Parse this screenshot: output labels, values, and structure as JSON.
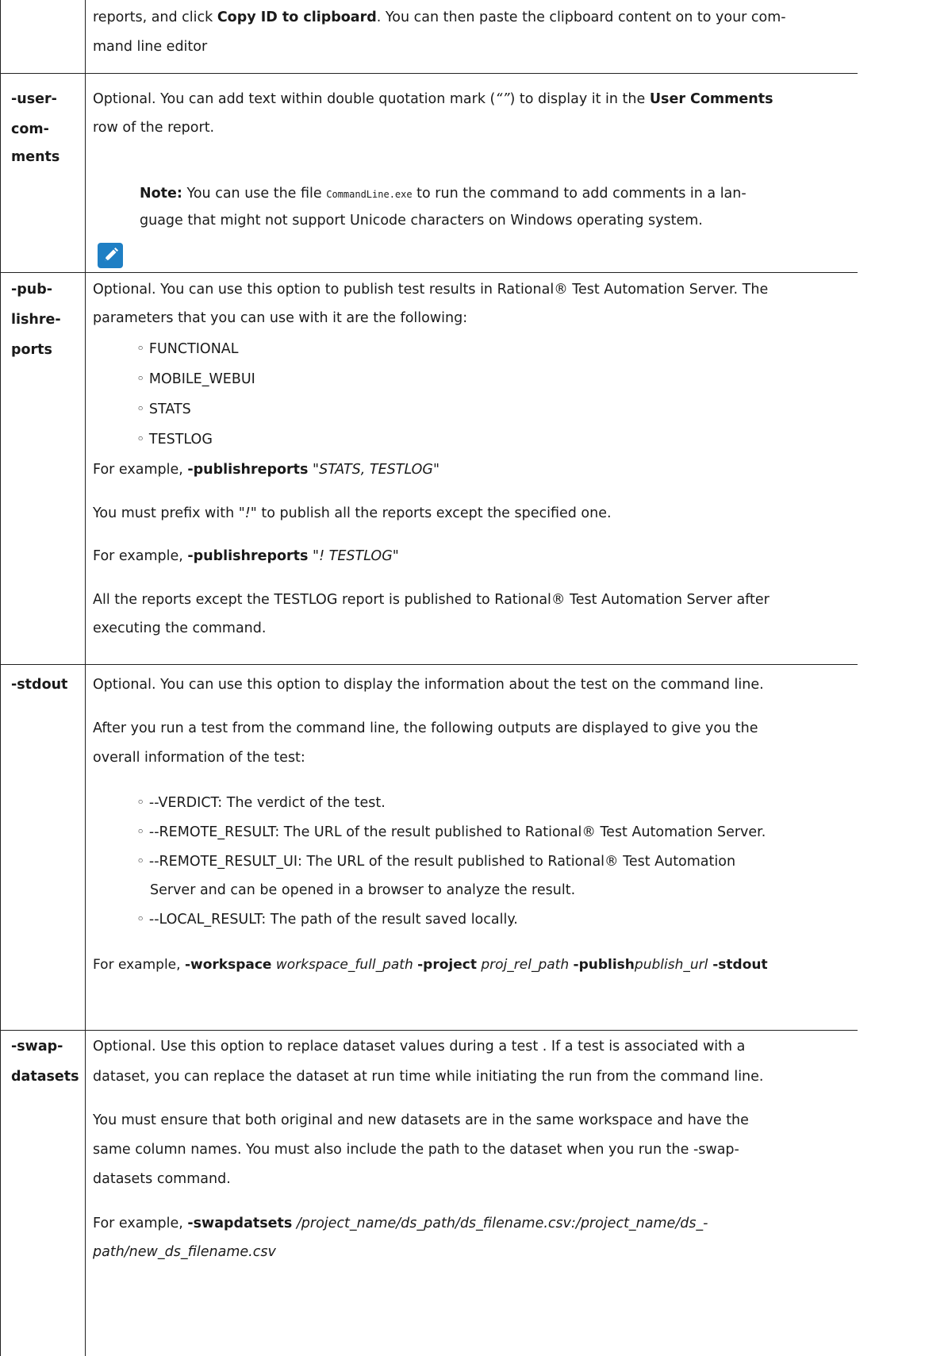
{
  "row_top": {
    "line1": {
      "a": "reports, and click ",
      "b": "Copy ID to clipboard",
      "c": ". You can then paste the clipboard content on to your com-"
    },
    "line2": "mand line editor"
  },
  "row_user_comments": {
    "key_lines": [
      "-user-",
      "com-",
      "ments"
    ],
    "line1": {
      "a": "Optional. You can add text within double quotation mark (",
      "q": "“”",
      "b": ") to display it in the ",
      "c": "User Comments"
    },
    "line2": "row of the report.",
    "note": {
      "label": "Note:",
      "a": " You can use the file ",
      "code": "CommandLine.exe",
      "b": " to run the command to add comments in a lan-",
      "line2": "guage that might not support Unicode characters on Windows operating system."
    }
  },
  "row_publishreports": {
    "key_lines": [
      "-pub-",
      "lishre-",
      "ports"
    ],
    "line1": "Optional. You can use this option to publish test results in Rational® Test Automation Server. The",
    "line2": "parameters that you can use with it are the following:",
    "params": [
      "FUNCTIONAL",
      "MOBILE_WEBUI",
      "STATS",
      "TESTLOG"
    ],
    "example1": {
      "a": "For example, ",
      "b": "-publishreports",
      "c": " \"STATS, TESTLOG\""
    },
    "prefix": {
      "a": "You must prefix with ",
      "b": "\"!\"",
      "c": " to publish all the reports except the specified one."
    },
    "example2": {
      "a": "For example, ",
      "b": "-publishreports",
      "c": " \"! TESTLOG\""
    },
    "result_line1": "All the reports except the TESTLOG report is published to Rational® Test Automation Server after",
    "result_line2": "executing the command."
  },
  "row_stdout": {
    "key": "-stdout",
    "line1": "Optional. You can use this option to display the information about the test on the command line.",
    "after1": "After you run a test from the command line, the following outputs are displayed to give you the",
    "after2": "overall information of the test:",
    "outputs": [
      "--VERDICT: The verdict of the test.",
      "--REMOTE_RESULT: The URL of the result published to Rational® Test Automation Server.",
      "--REMOTE_RESULT_UI: The URL of the result published to Rational® Test Automation",
      "--LOCAL_RESULT: The path of the result saved locally."
    ],
    "output3_cont": "Server and can be opened in a browser to analyze the result.",
    "example": {
      "a": "For example, ",
      "b": "-workspace",
      "c": " workspace_full_path ",
      "d": "-project",
      "e": " proj_rel_path ",
      "f": "-publish",
      "g": "publish_url",
      "h": " -stdout"
    }
  },
  "row_swapdatasets": {
    "key_lines": [
      "-swap-",
      "datasets"
    ],
    "line1": "Optional. Use this option to replace dataset values during a test . If a test is associated with a",
    "line2": "dataset, you can replace the dataset at run time while initiating the run from the command line.",
    "ensure1": "You must ensure that both original and new datasets are in the same workspace and have the",
    "ensure2": "same column names. You must also include the path to the dataset when you run the -swap-",
    "ensure3": "datasets command.",
    "example": {
      "a": "For example, ",
      "b": "-swapdatsets",
      "c": "  /project_name/ds_path/ds_filename.csv:/project_name/ds_-"
    },
    "example_line2": "path/new_ds_filename.csv"
  },
  "colors": {
    "note_icon": "#1f7fc4",
    "border": "#222222"
  },
  "icons": {
    "note": "pencil-icon",
    "bullet": "circle-bullet"
  }
}
